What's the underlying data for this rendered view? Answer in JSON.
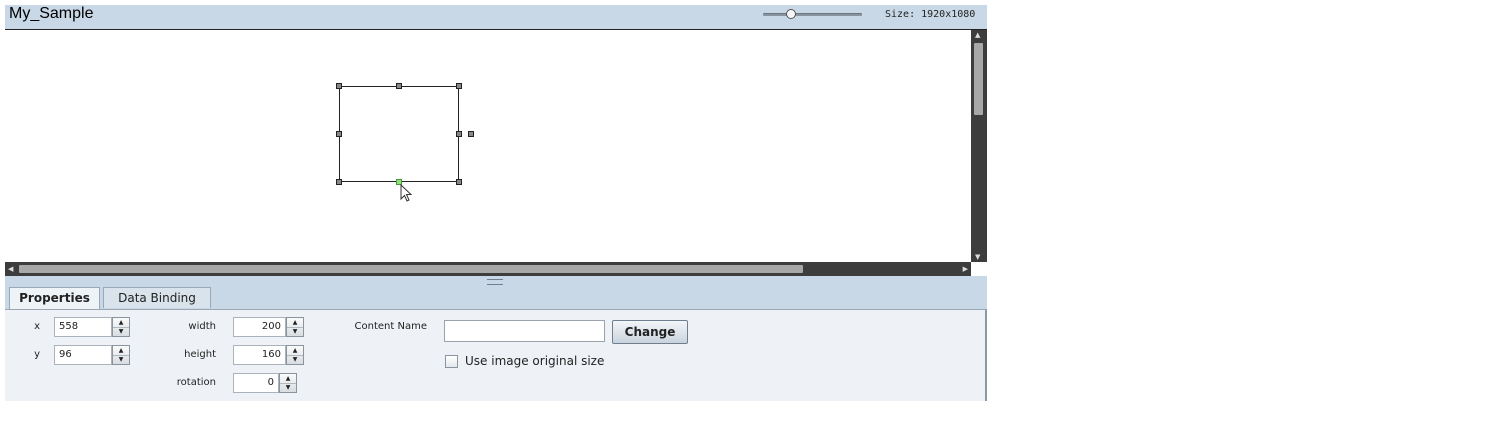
{
  "header": {
    "title": "My_Sample",
    "zoom_level_fraction": 0.33,
    "size_label": "Size: 1920x1080"
  },
  "canvas": {
    "background": "#ffffff",
    "selected_handle_color": "#8ee07a"
  },
  "tabs": [
    {
      "label": "Properties",
      "active": true
    },
    {
      "label": "Data Binding",
      "active": false
    }
  ],
  "properties": {
    "x_label": "x",
    "x_value": "558",
    "y_label": "y",
    "y_value": "96",
    "width_label": "width",
    "width_value": "200",
    "height_label": "height",
    "height_value": "160",
    "rotation_label": "rotation",
    "rotation_value": "0",
    "content_name_label": "Content Name",
    "content_name_value": "",
    "change_label": "Change",
    "use_original_size_label": "Use image original size",
    "use_original_size_checked": false
  },
  "colors": {
    "header_bg": "#c9d8e6",
    "panel_bg": "#eef2f6",
    "scrollbar_bg": "#3d3d3d"
  }
}
